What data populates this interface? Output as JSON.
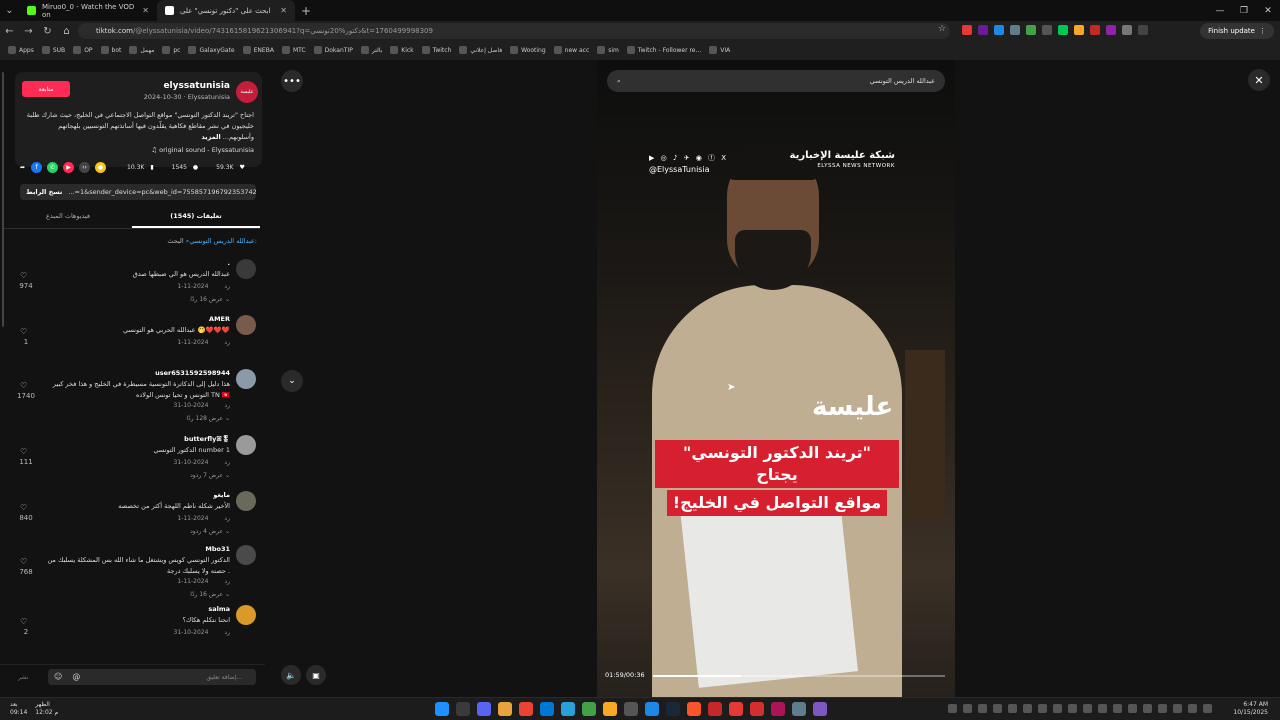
{
  "browser": {
    "tabs": [
      {
        "title": "Miruo0_0 - Watch the VOD on",
        "color": "#53fc18"
      },
      {
        "title": "ابحث على \"دكتور تونسي\" على",
        "color": "#ffffff"
      }
    ],
    "url_prefix": "tiktok.com",
    "url_rest": "/@elyssatunisia/video/7431615819621306941?q=دكتور%20تونسي&t=1760499998309",
    "finish_update": "Finish update",
    "bookmarks": [
      "Apps",
      "SUB",
      "OP",
      "bot",
      "مهمل",
      "pc",
      "GalaxyGate",
      "ENEBA",
      "MTC",
      "DokanTIP",
      "بالتر",
      "Kick",
      "Twitch",
      "فاصل إعلاني",
      "Wooting",
      "new acc",
      "sim",
      "Twitch - Follower re...",
      "VIA"
    ]
  },
  "post": {
    "follow_label": "متابعة",
    "author_name": "elyssatunisia",
    "author_meta": "2024-10-30 · Elyssatunisia",
    "brand_avatar_text": "عليسة",
    "description": "اجتاح \"تريند الدكتور التونسي\" مواقع التواصل الاجتماعي في الخليج، حيث شارك طلبة خليجيون في نشر مقاطع فكاهية يقلّدون فيها أساتذتهم التونسيين بلهجاتهم وأسلوبهم...",
    "more_label": "المزيد",
    "sound": "original sound - Elyssatunisia",
    "likes": "59.3K",
    "comments_count": "1545",
    "saves": "10.3K",
    "link_copy_label": "نسخ الرابط",
    "link_text": "...=1&sender_device=pc&web_id=7558571967923537426",
    "tab_comments": "تعليقات (1545)",
    "tab_creator_videos": "فيديوهات المبدع",
    "search_prefix": "البحث:",
    "search_query": "عبدالله الدريس التونسي"
  },
  "comments": [
    {
      "user": ".",
      "text": "عبدالله الدريس هو الي ضبطها صدق",
      "date": "2024-11-1",
      "reply": "رد",
      "replies": "عرض 16 ردًا",
      "likes": "974",
      "avatar": "#3a3a3a"
    },
    {
      "user": "AMER",
      "text": "عبدالله الحربي هو التونسي 🤭❤️❤️❤️",
      "date": "2024-11-1",
      "reply": "رد",
      "replies": "",
      "likes": "1",
      "avatar": "#7a5a4a"
    },
    {
      "user": "user6531592598944",
      "text": "هذا دليل إلى الدكاترة التونسية مسيطرة في الخليج و هذا فخر كبير التونس و تحيا تونس الولاده TN 🇹🇳",
      "date": "2024-10-31",
      "reply": "رد",
      "replies": "عرض 128 ردًا",
      "likes": "1740",
      "avatar": "#8a9aa8"
    },
    {
      "user": "butterflyꕤ🎖",
      "text": "الدكتور التونسي number 1",
      "date": "2024-10-31",
      "reply": "رد",
      "replies": "عرض 7 ردود",
      "likes": "111",
      "avatar": "#9a9a9a"
    },
    {
      "user": "مايغو",
      "text": "الأخير شكله ناطم اللهجة أكثر من تخصصه",
      "date": "2024-11-1",
      "reply": "رد",
      "replies": "عرض 4 ردود",
      "likes": "840",
      "avatar": "#6a6a5a"
    },
    {
      "user": "Mbo31",
      "text": "الدكتور التونسي كويس ويشتغل ما شاء الله بس المشكلة يسلبك من حصته ولا يسلبك درجة .",
      "date": "2024-11-1",
      "reply": "رد",
      "replies": "عرض 16 ردًا",
      "likes": "768",
      "avatar": "#4a4a4a"
    },
    {
      "user": "salma",
      "text": "انحنا نتكلم هكاك؟",
      "date": "2024-10-31",
      "reply": "رد",
      "replies": "",
      "likes": "2",
      "avatar": "#d99a2a"
    }
  ],
  "composer": {
    "placeholder": "إضافة تعليق...",
    "post_label": "نشر"
  },
  "video": {
    "search_text": "عبدالله الدريس التونسي",
    "brand_handle": "@ElyssaTunisia",
    "brand_icons": "▶ ◎ ♪ ✈ ◉ ⓕ X",
    "network_ar": "شبكة عليسة الإخبارية",
    "network_en": "ELYSSA NEWS NETWORK",
    "logo": "عليسة",
    "headline_1": "\"تريند الدكتور التونسي\" يجتاح",
    "headline_2": "مواقع التواصل في الخليج!",
    "time": "01:59/00:36",
    "progress": 0.3
  },
  "taskbar": {
    "weather_1": "بعد",
    "weather_2": "09:14",
    "prayer_1": "الظهر",
    "prayer_2": "12:02 م",
    "time": "6:47 AM",
    "date": "10/15/2025"
  },
  "colors": {
    "accent": "#fe2c55",
    "headline_red": "#d6202f",
    "link_blue": "#4db3ff"
  }
}
